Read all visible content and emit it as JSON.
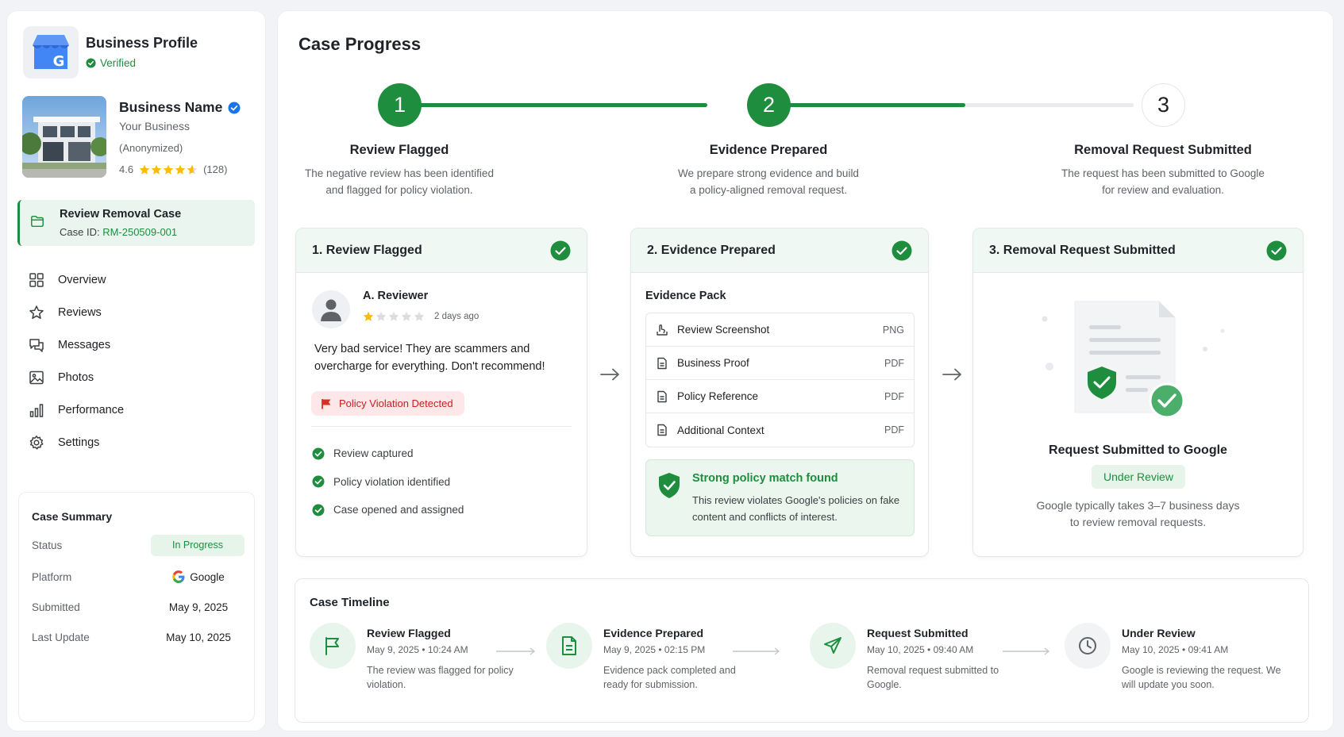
{
  "sidebar": {
    "profile_title": "Business Profile",
    "verified_label": "Verified",
    "business": {
      "name": "Business Name",
      "subtitle": "Your Business",
      "note": "(Anonymized)",
      "rating": "4.6",
      "rating_value": 4.6,
      "review_count": "(128)"
    },
    "case": {
      "title": "Review Removal Case",
      "id_label": "Case ID: ",
      "id_value": "RM-250509-001"
    },
    "nav": [
      {
        "label": "Overview",
        "icon": "grid-icon"
      },
      {
        "label": "Reviews",
        "icon": "star-outline-icon"
      },
      {
        "label": "Messages",
        "icon": "messages-icon"
      },
      {
        "label": "Photos",
        "icon": "image-icon"
      },
      {
        "label": "Performance",
        "icon": "bar-chart-icon"
      },
      {
        "label": "Settings",
        "icon": "gear-icon"
      }
    ],
    "summary": {
      "title": "Case Summary",
      "rows": [
        {
          "key": "Status",
          "value": "In Progress"
        },
        {
          "key": "Platform",
          "value": "Google"
        },
        {
          "key": "Submitted",
          "value": "May 9, 2025"
        },
        {
          "key": "Last Update",
          "value": "May 10, 2025"
        }
      ]
    }
  },
  "main": {
    "title": "Case Progress",
    "steps": [
      {
        "number": "1",
        "label": "Review Flagged",
        "desc_1": "The negative review has been identified",
        "desc_2": "and flagged for policy violation.",
        "state": "done"
      },
      {
        "number": "2",
        "label": "Evidence Prepared",
        "desc_1": "We prepare strong evidence and build",
        "desc_2": "a policy-aligned removal request.",
        "state": "done"
      },
      {
        "number": "3",
        "label": "Removal Request Submitted",
        "desc_1": "The request has been submitted to Google",
        "desc_2": "for review and evaluation.",
        "state": "pending"
      }
    ],
    "card1": {
      "title": "1. Review Flagged",
      "reviewer": "A. Reviewer",
      "rating": 1,
      "time": "2 days ago",
      "review_text": "Very bad service! They are scammers and overcharge for everything. Don't recommend!",
      "flag_label": "Policy Violation Detected",
      "checks": [
        "Review captured",
        "Policy violation identified",
        "Case opened and assigned"
      ]
    },
    "card2": {
      "title": "2. Evidence Prepared",
      "pack_title": "Evidence Pack",
      "items": [
        {
          "name": "Review Screenshot",
          "type": "PNG",
          "icon": "screenshot-icon"
        },
        {
          "name": "Business Proof",
          "type": "PDF",
          "icon": "document-icon"
        },
        {
          "name": "Policy Reference",
          "type": "PDF",
          "icon": "document-icon"
        },
        {
          "name": "Additional Context",
          "type": "PDF",
          "icon": "document-icon"
        }
      ],
      "match_title": "Strong policy match found",
      "match_text": "This review violates Google's policies on fake content and conflicts of interest."
    },
    "card3": {
      "title": "3. Removal Request Submitted",
      "sub_title": "Request Submitted to Google",
      "status_pill": "Under Review",
      "text_1": "Google typically takes 3–7 business days",
      "text_2": "to review removal requests."
    },
    "timeline": {
      "title": "Case Timeline",
      "items": [
        {
          "name": "Review Flagged",
          "date": "May 9, 2025 • 10:24 AM",
          "desc": "The review was flagged for policy violation.",
          "icon": "flag-icon"
        },
        {
          "name": "Evidence Prepared",
          "date": "May 9, 2025 • 02:15 PM",
          "desc": "Evidence pack completed and ready for submission.",
          "icon": "document-icon"
        },
        {
          "name": "Request Submitted",
          "date": "May 10, 2025 • 09:40 AM",
          "desc": "Removal request submitted to Google.",
          "icon": "send-icon"
        },
        {
          "name": "Under Review",
          "date": "May 10, 2025 • 09:41 AM",
          "desc": "Google is reviewing the request. We will update you soon.",
          "icon": "clock-icon"
        }
      ]
    }
  },
  "colors": {
    "accent_green": "#1e8e3e",
    "light_green": "#e6f4ea",
    "danger_red": "#c5221f",
    "star_gold": "#fbbc04",
    "verified_blue": "#1a73e8"
  }
}
